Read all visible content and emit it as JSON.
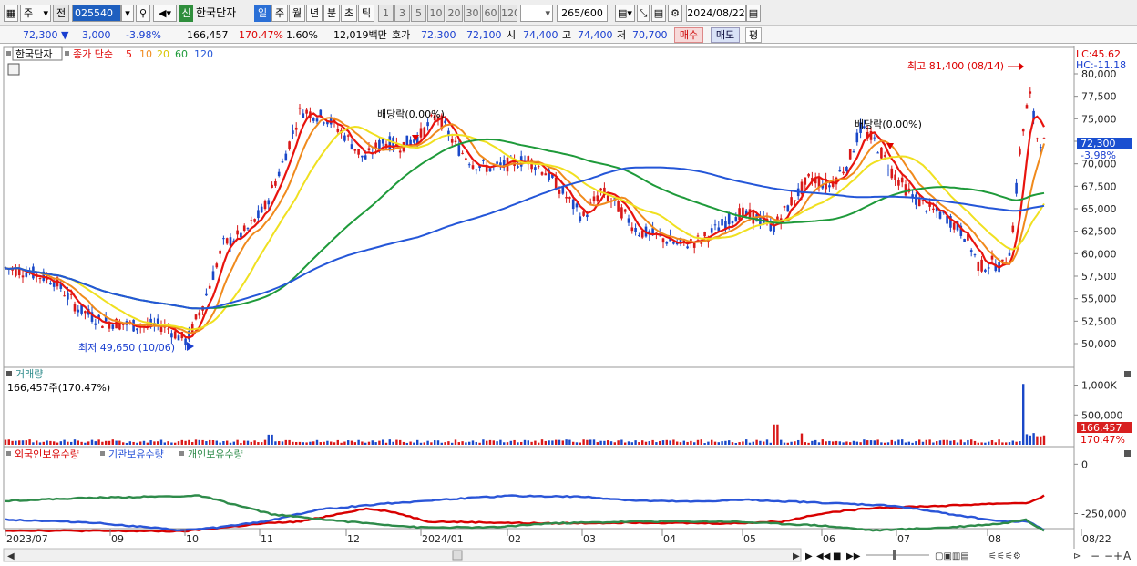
{
  "toolbar": {
    "period_type": "주",
    "prev_label": "전",
    "stock_code": "025540",
    "stock_tag": "신",
    "stock_name": "한국단자",
    "period_tabs": [
      {
        "label": "일",
        "selected": true
      },
      {
        "label": "주",
        "selected": false
      },
      {
        "label": "월",
        "selected": false
      },
      {
        "label": "년",
        "selected": false
      },
      {
        "label": "분",
        "selected": false
      },
      {
        "label": "초",
        "selected": false
      },
      {
        "label": "틱",
        "selected": false
      }
    ],
    "interval_tabs": [
      "1",
      "3",
      "5",
      "10",
      "20",
      "30",
      "60",
      "120"
    ],
    "bar_count": "265",
    "bar_total": "/600",
    "date": "2024/08/22"
  },
  "quote": {
    "price": "72,300",
    "change": "3,000",
    "change_pct": "-3.98%",
    "volume": "166,457",
    "volume_pct": "170.47%",
    "turnover_pct": "1.60%",
    "amount": "12,019백만",
    "bid_label": "호가",
    "ask_price": "72,300",
    "bid_price": "72,100",
    "open_label": "시",
    "open": "74,400",
    "high_label": "고",
    "high": "74,400",
    "low_label": "저",
    "low": "70,700",
    "buy_label": "매수",
    "sell_label": "매도",
    "avg_label": "평"
  },
  "price_panel": {
    "name_tag": "한국단자",
    "ma_label": "종가 단순",
    "ma_periods": [
      "5",
      "10",
      "20",
      "60",
      "120"
    ],
    "ma_colors": [
      "#e8140e",
      "#f08a1c",
      "#f0e020",
      "#1e9a3a",
      "#2456d8"
    ],
    "lc": "LC:45.62",
    "hc": "HC:-11.18",
    "max_annotation": "최고 81,400 (08/14)",
    "min_annotation": "최저 49,650 (10/06)",
    "dividend_1": "배당락(0.00%)",
    "dividend_2": "배당락(0.00%)",
    "current_price": "72,300",
    "current_change": "-3.98%",
    "y_ticks": [
      "80,000",
      "77,500",
      "75,000",
      "72,500",
      "70,000",
      "67,500",
      "65,000",
      "62,500",
      "60,000",
      "57,500",
      "55,000",
      "52,500",
      "50,000"
    ]
  },
  "volume_panel": {
    "title": "거래량",
    "value": "166,457주(170.47%)",
    "y_ticks": [
      "1,000K",
      "500,000"
    ],
    "current": "166,457",
    "current_pct": "170.47%"
  },
  "holding_panel": {
    "series": [
      "외국인보유수량",
      "기관보유수량",
      "개인보유수량"
    ],
    "colors": [
      "#d80000",
      "#2a55d8",
      "#2e8b4a"
    ],
    "y_ticks": [
      "0",
      "-250,000"
    ]
  },
  "x_axis": [
    "2023/07",
    "09",
    "10",
    "11",
    "12",
    "2024/01",
    "02",
    "03",
    "04",
    "05",
    "06",
    "07",
    "08",
    "08/22"
  ]
}
